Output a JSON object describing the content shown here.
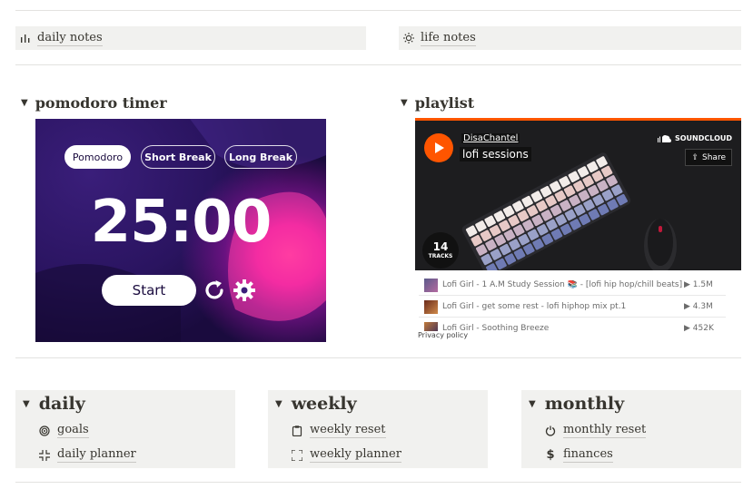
{
  "top_links": {
    "daily_notes": "daily notes",
    "life_notes": "life notes"
  },
  "pomodoro": {
    "heading": "pomodoro timer",
    "modes": [
      "Pomodoro",
      "Short Break",
      "Long Break"
    ],
    "active_mode": "Pomodoro",
    "time": "25:00",
    "start_label": "Start"
  },
  "playlist": {
    "heading": "playlist",
    "user": "DisaChantel",
    "title": "lofi sessions",
    "brand": "SOUNDCLOUD",
    "share_label": "Share",
    "track_count": "14",
    "track_count_label": "TRACKS",
    "tracks": [
      {
        "title": "Lofi Girl - 1 A.M Study Session 📚 - [lofi hip hop/chill beats]",
        "plays": "1.5M"
      },
      {
        "title": "Lofi Girl - get some rest - lofi hiphop mix pt.1",
        "plays": "4.3M"
      },
      {
        "title": "Lofi Girl - Soothing Breeze",
        "plays": "452K"
      }
    ],
    "privacy": "Privacy policy"
  },
  "sections": {
    "daily": {
      "title": "daily",
      "items": [
        "goals",
        "daily planner"
      ]
    },
    "weekly": {
      "title": "weekly",
      "items": [
        "weekly reset",
        "weekly planner"
      ]
    },
    "monthly": {
      "title": "monthly",
      "items": [
        "monthly reset",
        "finances"
      ]
    }
  },
  "colors": {
    "accent_orange": "#ff5500",
    "box_bg": "#f1f1ef",
    "text": "#37352f"
  },
  "icons": {
    "daily_notes": "bar-chart-icon",
    "life_notes": "sun-icon",
    "goals": "target-icon",
    "daily_planner": "shrink-icon",
    "weekly_reset": "clipboard-icon",
    "weekly_planner": "expand-icon",
    "monthly_reset": "power-icon",
    "finances": "dollar-icon"
  }
}
